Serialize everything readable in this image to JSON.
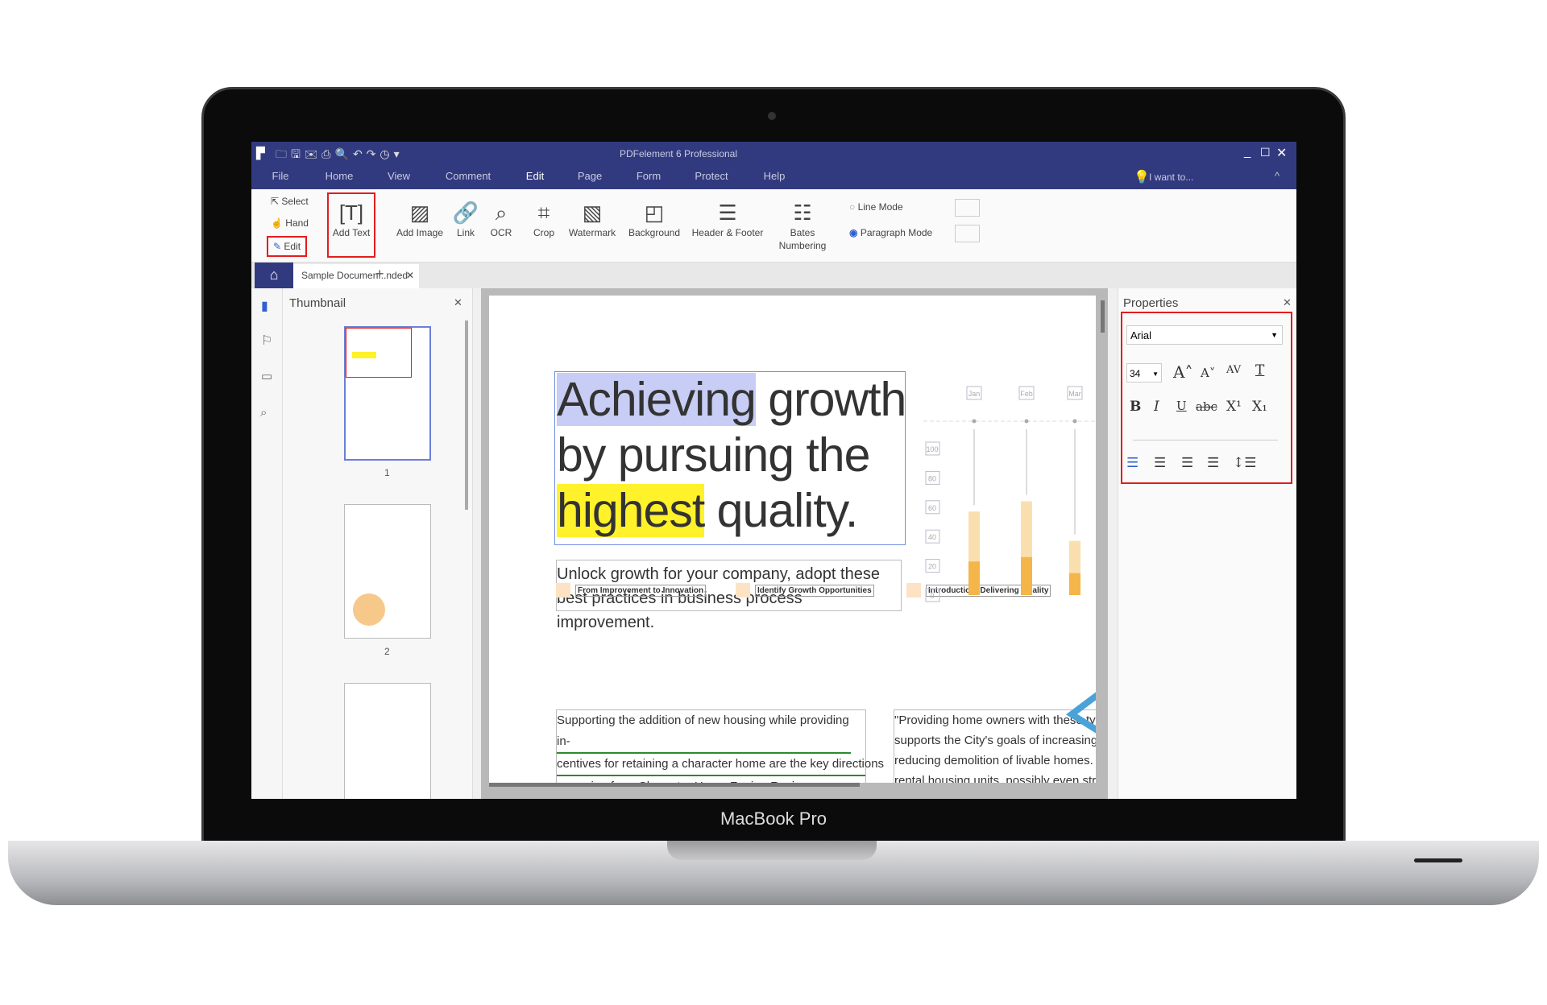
{
  "device": {
    "brand": "MacBook Pro"
  },
  "window": {
    "title": "PDFelement 6 Professional",
    "search_placeholder": "I want to..."
  },
  "menu": [
    "File",
    "Home",
    "View",
    "Comment",
    "Edit",
    "Page",
    "Form",
    "Protect",
    "Help"
  ],
  "menu_active": "Edit",
  "edit_modes": {
    "select": "Select",
    "hand": "Hand",
    "edit": "Edit"
  },
  "tools": [
    {
      "label": "Add Text",
      "icon": "add-text-icon",
      "glyph": "[T]"
    },
    {
      "label": "Add Image",
      "icon": "image-icon",
      "glyph": "▨"
    },
    {
      "label": "Link",
      "icon": "link-icon",
      "glyph": "🔗"
    },
    {
      "label": "OCR",
      "icon": "ocr-icon",
      "glyph": "⌕"
    },
    {
      "label": "Crop",
      "icon": "crop-icon",
      "glyph": "⌗"
    },
    {
      "label": "Watermark",
      "icon": "watermark-icon",
      "glyph": "▧"
    },
    {
      "label": "Background",
      "icon": "background-icon",
      "glyph": "◰"
    },
    {
      "label": "Header & Footer",
      "icon": "header-footer-icon",
      "glyph": "☰"
    },
    {
      "label": "Bates\nNumbering",
      "icon": "bates-icon",
      "glyph": "☷"
    }
  ],
  "modes": {
    "line": "Line Mode",
    "paragraph": "Paragraph Mode",
    "selected": "paragraph"
  },
  "tab": {
    "label": "Sample Documen...nded",
    "add": "+"
  },
  "thumbnail": {
    "title": "Thumbnail",
    "pages": [
      "1",
      "2"
    ]
  },
  "properties": {
    "title": "Properties",
    "font": "Arial",
    "size": "34",
    "buttons": {
      "grow": "A˄",
      "shrink": "A˅",
      "spacing": "AV",
      "textcolor": "T",
      "bold": "B",
      "italic": "I",
      "underline": "U",
      "strike": "abc",
      "sup": "X¹",
      "sub": "X₁"
    }
  },
  "document": {
    "headline": {
      "w1": "Achieving",
      "r1": " growth",
      "l2": "by pursuing the",
      "w3": "highest",
      "r3": " quality."
    },
    "subtitle": "Unlock growth for your company, adopt these best practices in business process improvement.",
    "labels": [
      "From Improvement to Innovation",
      "Identify Growth Opportunities",
      "Introduction: Delivering Quality"
    ],
    "para_left": [
      "Supporting the addition of new housing while providing in-",
      "centives for retaining a character home are the key directions",
      "emerging from Character Home Zoning Review."
    ],
    "para_right": [
      "\"Providing home owners with these types",
      "supports the City's goals of increasing ho",
      "reducing demolition of livable homes.  It c",
      "rental housing units, possibly even strata"
    ]
  },
  "chart_data": {
    "type": "bar",
    "categories": [
      "Jan",
      "Feb",
      "Mar"
    ],
    "yticks": [
      "100",
      "80",
      "60",
      "40",
      "20",
      "0"
    ],
    "ylim": [
      0,
      100
    ],
    "series": [
      {
        "values": [
          23,
          26,
          15
        ],
        "color": "#f4b648"
      },
      {
        "values": [
          57,
          64,
          37
        ],
        "color": "#fadfae"
      }
    ]
  },
  "colors": {
    "titlebar": "#323a7f",
    "accent": "#2f5fd0",
    "highlight_select": "#c8cdf5",
    "highlight_yellow": "#fff12a",
    "annotation_box": "#e31d1d"
  }
}
